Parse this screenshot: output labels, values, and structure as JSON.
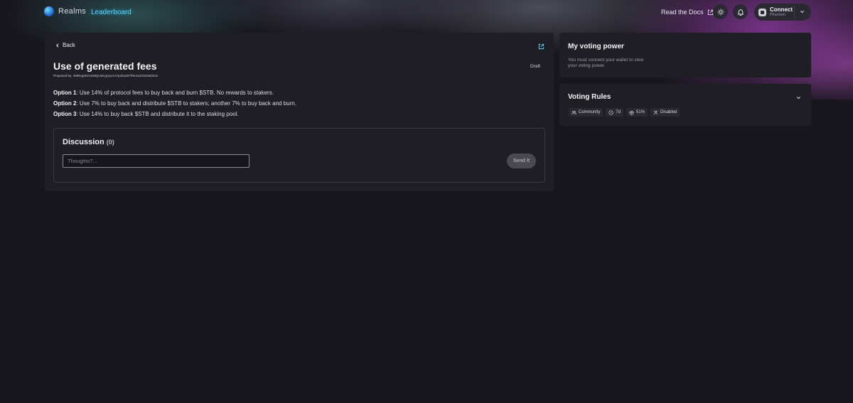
{
  "header": {
    "logo_text": "Realms",
    "nav_leaderboard": "Leaderboard",
    "docs_label": "Read the Docs",
    "connect_label": "Connect",
    "connect_sub": "Phantom"
  },
  "proposal": {
    "back_label": "Back",
    "title": "Use of generated fees",
    "proposed_by": "Proposed by: 4MRegdxXAHMQUwryjzqoAUYpohoZ97fSKJa4GDXwDDJv",
    "status": "Draft",
    "options": [
      {
        "label": "Option 1",
        "text": ": Use 14% of protocol fees to buy back and burn $STB. No rewards to stakers."
      },
      {
        "label": "Option 2",
        "text": ": Use 7% to buy back and distribute $STB to stakers; another 7% to buy back and burn."
      },
      {
        "label": "Option 3",
        "text": ": Use 14% to buy back $STB and distribute it to the staking pool."
      }
    ]
  },
  "discussion": {
    "title": "Discussion",
    "count": "(0)",
    "placeholder": "Thoughts?...",
    "send_label": "Send It"
  },
  "voting_power": {
    "title": "My voting power",
    "message": "You must connect your wallet to view your voting power"
  },
  "voting_rules": {
    "title": "Voting Rules",
    "chips": [
      "Community",
      "7d",
      "51%",
      "Disabled"
    ]
  },
  "colors": {
    "background": "#17161c",
    "card": "#1f1e25",
    "accent": "#5fd6ff",
    "glow_purple": "#963caa"
  }
}
